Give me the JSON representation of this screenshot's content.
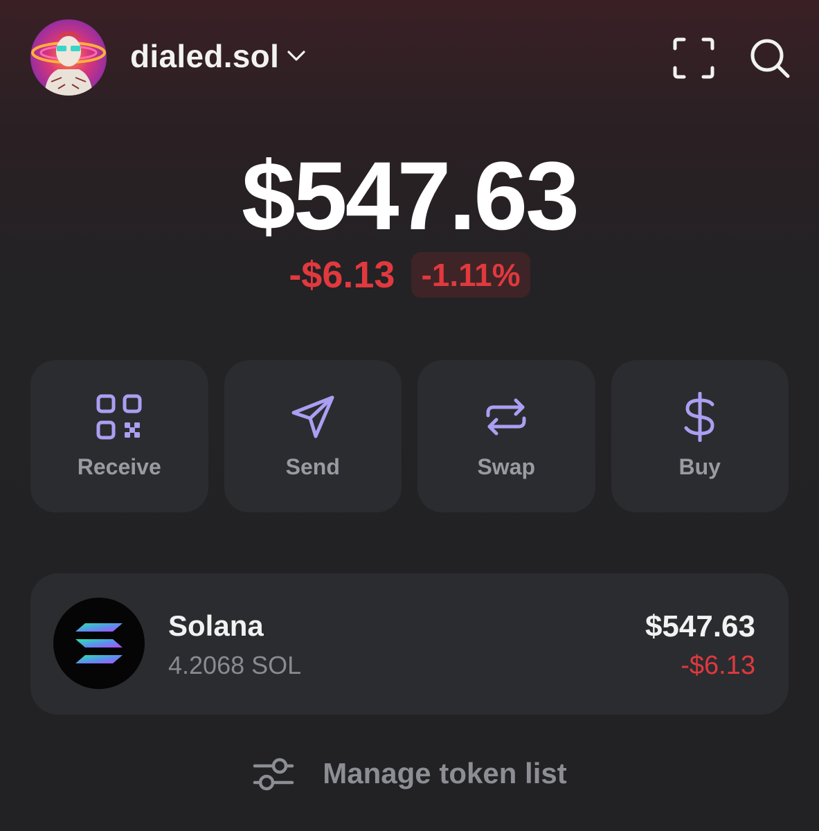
{
  "header": {
    "account_name": "dialed.sol",
    "icons": {
      "chevron": "chevron-down-icon",
      "scan": "scan-icon",
      "search": "search-icon"
    }
  },
  "balance": {
    "total": "$547.63",
    "change_usd": "-$6.13",
    "change_pct": "-1.11%"
  },
  "actions": [
    {
      "label": "Receive",
      "icon": "qr-code-icon"
    },
    {
      "label": "Send",
      "icon": "send-icon"
    },
    {
      "label": "Swap",
      "icon": "swap-icon"
    },
    {
      "label": "Buy",
      "icon": "dollar-icon"
    }
  ],
  "tokens": [
    {
      "name": "Solana",
      "amount": "4.2068 SOL",
      "value": "$547.63",
      "change": "-$6.13",
      "icon": "solana-logo-icon"
    }
  ],
  "manage": {
    "label": "Manage token list",
    "icon": "sliders-icon"
  },
  "colors": {
    "accent": "#ab9ff2",
    "negative": "#e0393e",
    "card": "#2b2c30",
    "background": "#222225"
  }
}
